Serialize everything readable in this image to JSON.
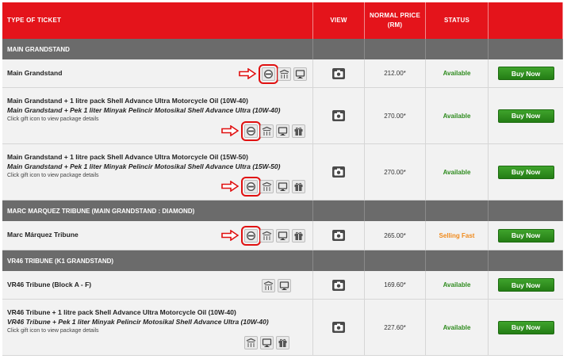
{
  "header": {
    "type": "TYPE OF TICKET",
    "view": "VIEW",
    "price_line1": "NORMAL PRICE",
    "price_line2": "(RM)",
    "status": "STATUS"
  },
  "sections": [
    {
      "title": "MAIN GRANDSTAND",
      "rows": [
        {
          "name": "Main Grandstand",
          "price": "212.00*",
          "status": "Available",
          "button": "Buy Now"
        },
        {
          "name": "Main Grandstand + 1 litre pack Shell Advance Ultra Motorcycle Oil (10W-40)",
          "name_ms": "Main Grandstand + Pek 1 liter Minyak Pelincir Motosikal Shell Advance Ultra (10W-40)",
          "hint": "Click gift icon to view package details",
          "price": "270.00*",
          "status": "Available",
          "button": "Buy Now"
        },
        {
          "name": "Main Grandstand + 1 litre pack Shell Advance Ultra Motorcycle Oil (15W-50)",
          "name_ms": "Main Grandstand + Pek 1 liter Minyak Pelincir Motosikal Shell Advance Ultra (15W-50)",
          "hint": "Click gift icon to view package details",
          "price": "270.00*",
          "status": "Available",
          "button": "Buy Now"
        }
      ]
    },
    {
      "title": "MARC MARQUEZ TRIBUNE (MAIN GRANDSTAND : DIAMOND)",
      "rows": [
        {
          "name": "Marc Márquez Tribune",
          "price": "265.00*",
          "status": "Selling Fast",
          "button": "Buy Now"
        }
      ]
    },
    {
      "title": "VR46 TRIBUNE (K1 GRANDSTAND)",
      "rows": [
        {
          "name": "VR46 Tribune (Block A - F)",
          "price": "169.60*",
          "status": "Available",
          "button": "Buy Now"
        },
        {
          "name": "VR46 Tribune + 1 litre pack Shell Advance Ultra Motorcycle Oil (10W-40)",
          "name_ms": "VR46 Tribune + Pek 1 liter Minyak Pelincir Motosikal Shell Advance Ultra (10W-40)",
          "hint": "Click gift icon to view package details",
          "price": "227.60*",
          "status": "Available",
          "button": "Buy Now"
        }
      ]
    }
  ],
  "colors": {
    "header_red": "#e4141b",
    "section_gray": "#6b6b6b",
    "available_green": "#2e8b1e",
    "selling_fast_orange": "#f08a1c",
    "button_green": "#2f8f1f",
    "highlight_red": "#e01010"
  },
  "icons": [
    "seat-badge-icon",
    "covered-stand-icon",
    "tv-screen-icon",
    "gift-icon",
    "camera-icon",
    "red-arrow-icon"
  ]
}
